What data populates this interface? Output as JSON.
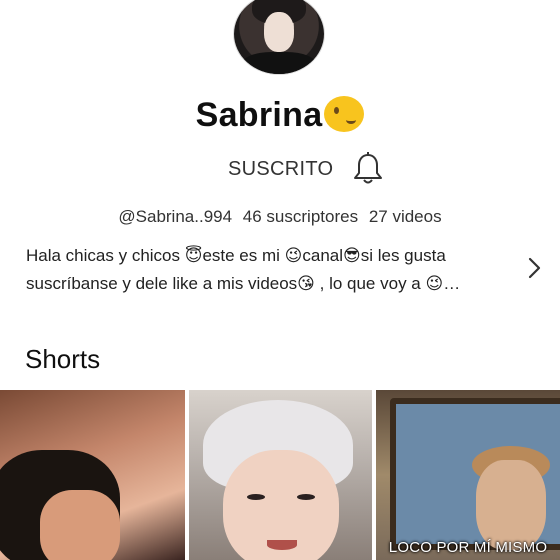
{
  "channel": {
    "name": "Sabrina",
    "name_emoji": "winking-face-emoji",
    "handle": "@Sabrina..994",
    "subscribers": "46 suscriptores",
    "videos": "27 videos"
  },
  "subscribe": {
    "label": "SUSCRITO"
  },
  "description": {
    "line1": "Hala chicas y chicos 😇este es mi 😉canal😎si les gusta",
    "line2": "suscríbanse y dele like a mis videos😘 ,  lo que voy a 😉…"
  },
  "sections": {
    "shorts_title": "Shorts"
  },
  "shorts": [
    {
      "caption": ""
    },
    {
      "caption": ""
    },
    {
      "caption": "LOCO POR MÍ MISMO"
    }
  ],
  "icons": {
    "bell": "bell-icon",
    "more": "chevron-right-icon"
  },
  "colors": {
    "text": "#0f0f0f",
    "secondary": "#333333"
  }
}
